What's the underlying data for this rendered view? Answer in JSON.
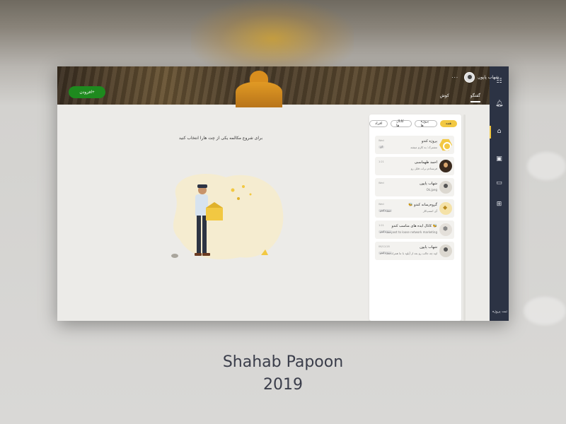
{
  "app": {
    "create_button": "افزودن+",
    "user": {
      "name": "شهاب پاپون",
      "more": "···"
    },
    "tabs": [
      {
        "label": "گفتگو",
        "active": true
      },
      {
        "label": "کوش",
        "active": false
      }
    ],
    "nav": {
      "icons": [
        "checklist-icon",
        "bell-icon",
        "home-icon",
        "bag-icon",
        "folder-icon",
        "gamepad-icon"
      ],
      "active_index": 2,
      "bottom_label": "ثبت پروژه"
    },
    "filters": [
      {
        "label": "همه",
        "active": true
      },
      {
        "label": "پروژه ها",
        "active": false
      },
      {
        "label": "کانال ها",
        "active": false
      },
      {
        "label": "افراد",
        "active": false
      }
    ],
    "empty_state": {
      "text": "برای شروع مکالمه یکی از چت هارا انتخاب کنید"
    },
    "chats": [
      {
        "title": "پروژه کندو",
        "preview": "مشترک: به کارم میشه",
        "time": "Wed",
        "badge": "آی",
        "avatar": "hex"
      },
      {
        "title": "احمد طهماسبی",
        "preview": "فرستادم برات فایل رو",
        "time": "1:21",
        "badge": "",
        "avatar": "dark"
      },
      {
        "title": "شهاب پاپون",
        "preview": "Ok.jpeg",
        "time": "Wed",
        "badge": "",
        "avatar": "light"
      },
      {
        "title": "🐝 گروه‌رسانه کندو",
        "preview": "آی اسنپ‌کار",
        "time": "Wed",
        "badge": "پروژه کندو",
        "avatar": "group"
      },
      {
        "title": "کانال ایده های مناسب کندو 🐝",
        "preview": "vikipost to loose network marketing",
        "time": "1:21",
        "badge": "پروژه کندو",
        "avatar": "channel"
      },
      {
        "title": "شهاب پاپون",
        "preview": "اوه چه جالب رو بعد از آپلود با ما همراه باشید",
        "time": "06/12/18",
        "badge": "پروژه کندو",
        "avatar": "light"
      }
    ]
  },
  "caption": {
    "name": "Shahab Papoon",
    "year": "2019"
  },
  "colors": {
    "accent": "#f2c842",
    "nav_bg": "#2c3344",
    "create_btn": "#1e8a1e",
    "canvas": "#ecebe8"
  }
}
